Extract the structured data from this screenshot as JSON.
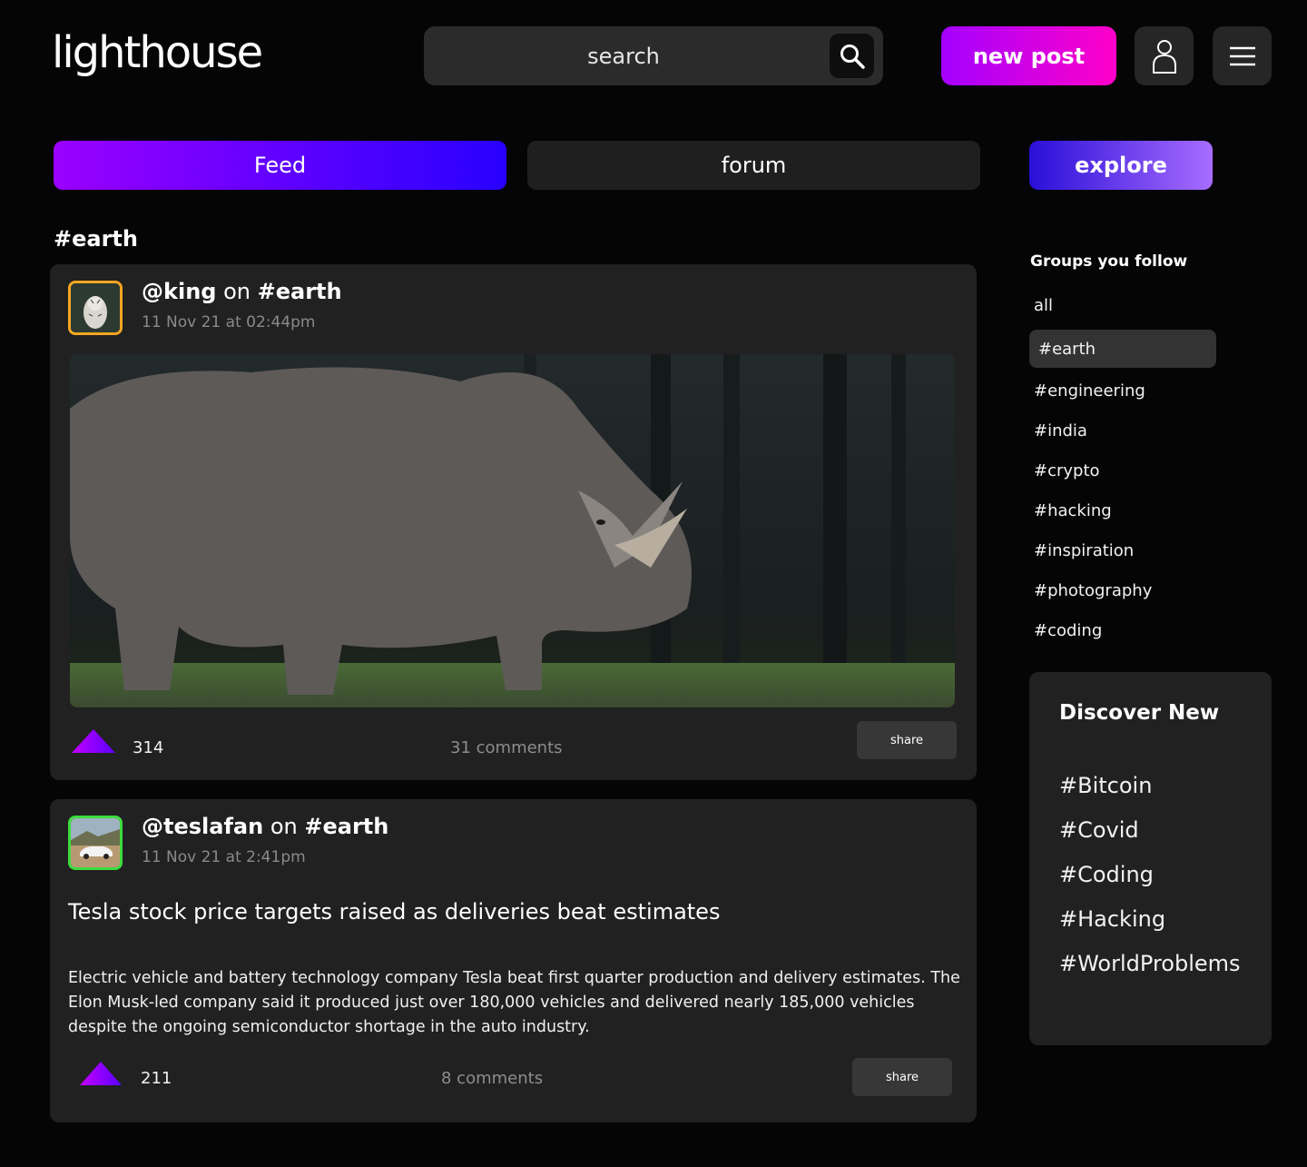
{
  "header": {
    "logo": "lighthouse",
    "search_placeholder": "search",
    "new_post_label": "new post"
  },
  "tabs": {
    "feed": "Feed",
    "forum": "forum",
    "explore": "explore"
  },
  "feed_title": "#earth",
  "posts": [
    {
      "user": "@king",
      "on": "on",
      "group": "#earth",
      "date": "11 Nov 21 at 02:44pm",
      "votes": "314",
      "comments": "31 comments",
      "share": "share",
      "avatar_border": "#f5a623"
    },
    {
      "user": "@teslafan",
      "on": "on",
      "group": "#earth",
      "date": "11 Nov 21 at 2:41pm",
      "headline": "Tesla stock price targets raised as deliveries beat estimates",
      "body": "Electric vehicle and battery technology company Tesla beat first quarter production and delivery estimates. The Elon Musk-led company said it produced just over 180,000 vehicles and delivered nearly 185,000 vehicles despite the ongoing semiconductor shortage in the auto industry.",
      "votes": "211",
      "comments": "8 comments",
      "share": "share",
      "avatar_border": "#3ddc3d"
    }
  ],
  "sidebar": {
    "groups_title": "Groups you follow",
    "groups": [
      "all",
      "#earth",
      "#engineering",
      "#india",
      "#crypto",
      "#hacking",
      "#inspiration",
      "#photography",
      "#coding"
    ],
    "active_group": "#earth",
    "discover_title": "Discover New",
    "discover": [
      "#Bitcoin",
      "#Covid",
      "#Coding",
      "#Hacking",
      "#WorldProblems"
    ]
  },
  "colors": {
    "background": "#050505",
    "card": "#212121",
    "accent_purple": "#9a00ff",
    "accent_pink": "#ff00c8",
    "accent_blue": "#2800ff"
  },
  "icons": [
    "search-icon",
    "user-icon",
    "menu-icon",
    "upvote-icon"
  ]
}
